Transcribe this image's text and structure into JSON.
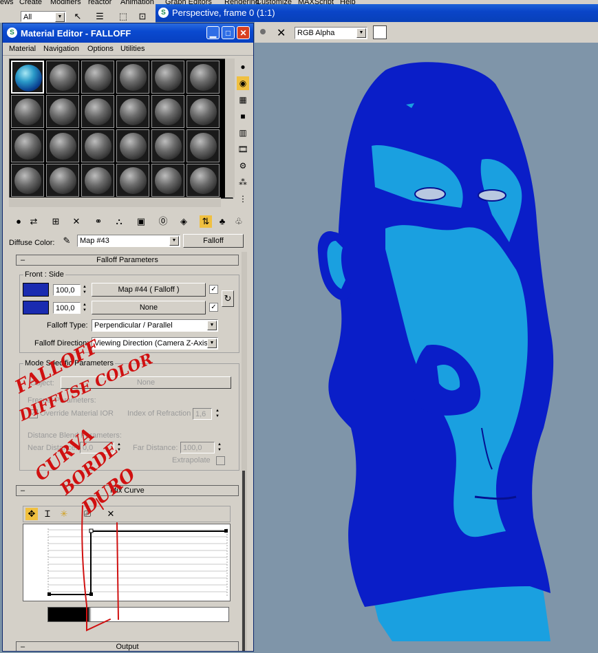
{
  "app_menu": [
    "ews",
    "Create",
    "Modifiers",
    "reactor",
    "Animation",
    "Graph Editors",
    "Rendering",
    "Customize",
    "MAXScript",
    "Help"
  ],
  "app_toolbar": {
    "selection_filter": "All"
  },
  "viewport": {
    "title": "Perspective, frame 0 (1:1)",
    "channel": "RGB Alpha",
    "colors": {
      "dark_blue": "#0a1ec8",
      "light_blue": "#1aa0e0",
      "background": "#7f95a9"
    }
  },
  "material_editor": {
    "title": "Material Editor - FALLOFF",
    "menu": [
      "Material",
      "Navigation",
      "Options",
      "Utilities"
    ],
    "diffuse_label": "Diffuse Color:",
    "map_name": "Map #43",
    "map_type": "Falloff",
    "falloff_params": {
      "header": "Falloff Parameters",
      "front_side_label": "Front : Side",
      "row1": {
        "amount": "100,0",
        "map": "Map #44  ( Falloff )",
        "enabled": true
      },
      "row2": {
        "amount": "100,0",
        "map": "None",
        "enabled": true
      },
      "falloff_type_label": "Falloff Type:",
      "falloff_type": "Perpendicular / Parallel",
      "falloff_direction_label": "Falloff Direction:",
      "falloff_direction": "Viewing Direction (Camera Z-Axis)"
    },
    "mode_specific": {
      "header": "Mode Specific Parameters",
      "object_label": "Object:",
      "object_value": "None",
      "fresnel_label": "Fresnel Parameters:",
      "override_ior_label": "Override Material IOR",
      "ior_label": "Index of Refraction",
      "ior_value": "1,6",
      "distance_blend_label": "Distance Blend Parameters:",
      "near_label": "Near Distance:",
      "near_value": "0,0",
      "far_label": "Far Distance:",
      "far_value": "100,0",
      "extrapolate_label": "Extrapolate"
    },
    "mix_curve": {
      "header": "Mix Curve",
      "y_top": "1",
      "y_bottom": "0"
    },
    "output_header": "Output"
  },
  "annotations": {
    "note1": [
      "FALLOFF",
      "DIFFUSE COLOR"
    ],
    "note2": [
      "CURVA",
      "BORDE",
      "DURO"
    ],
    "color": "#d01010"
  }
}
